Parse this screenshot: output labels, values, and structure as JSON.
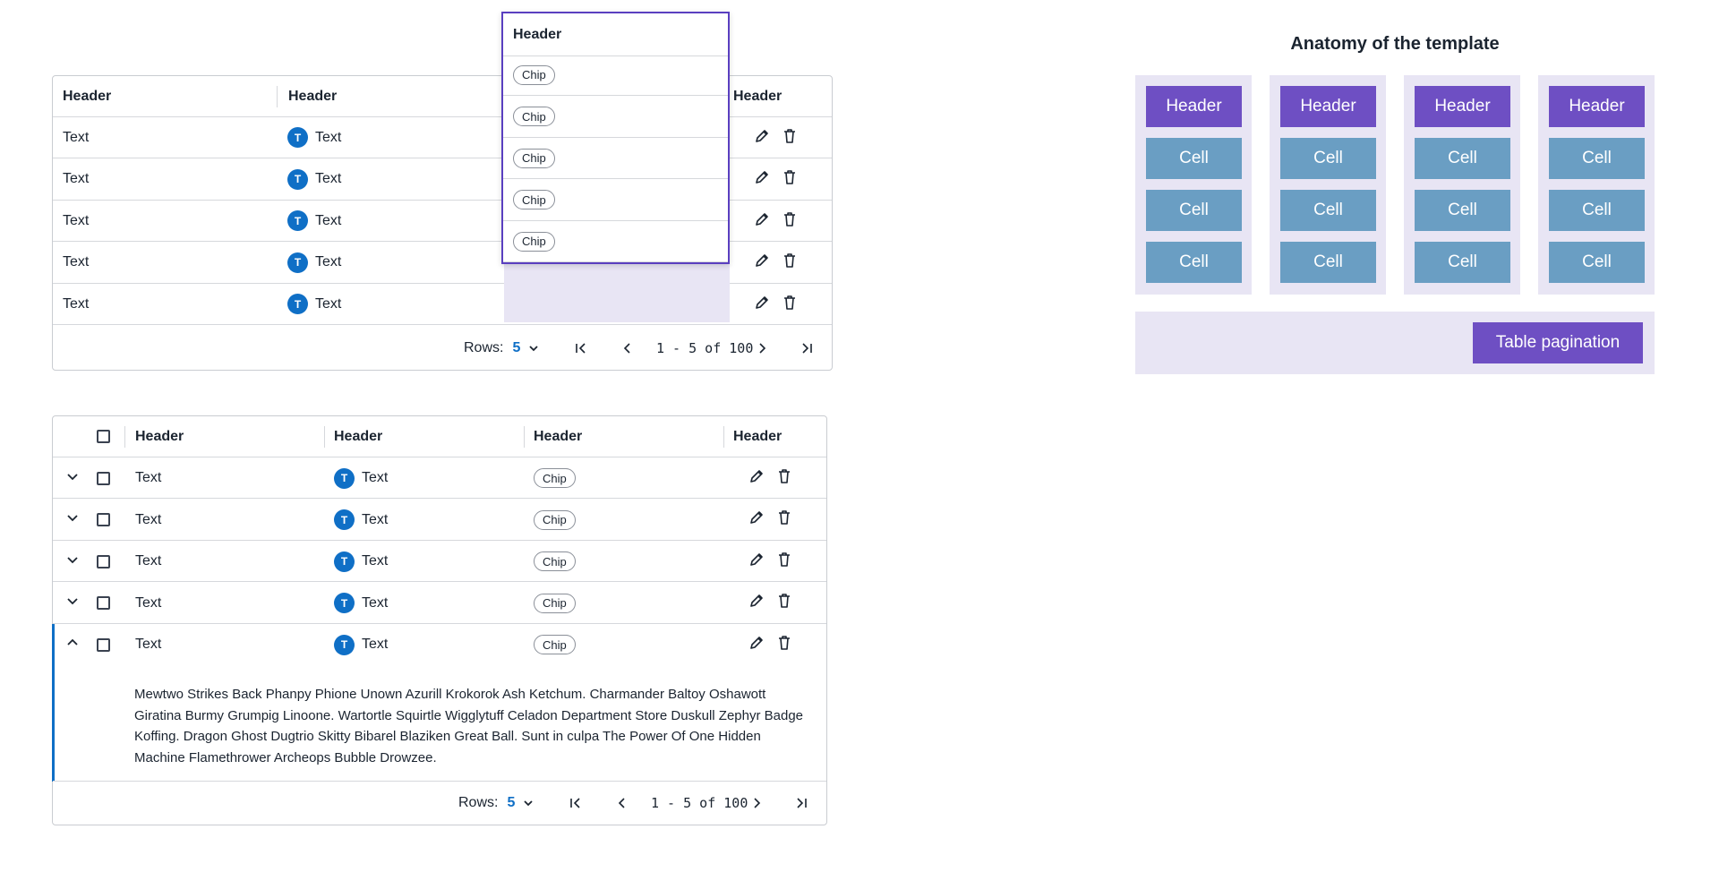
{
  "table1": {
    "headers": [
      "Header",
      "Header",
      "Header"
    ],
    "rows": [
      {
        "text": "Text",
        "avatar": "T",
        "user": "Text"
      },
      {
        "text": "Text",
        "avatar": "T",
        "user": "Text"
      },
      {
        "text": "Text",
        "avatar": "T",
        "user": "Text"
      },
      {
        "text": "Text",
        "avatar": "T",
        "user": "Text"
      },
      {
        "text": "Text",
        "avatar": "T",
        "user": "Text"
      }
    ],
    "pagination": {
      "rows_label": "Rows:",
      "rows_value": "5",
      "range": "1 - 5 of 100"
    }
  },
  "dragged_column": {
    "header": "Header",
    "chips": [
      "Chip",
      "Chip",
      "Chip",
      "Chip",
      "Chip"
    ]
  },
  "table2": {
    "headers": [
      "Header",
      "Header",
      "Header",
      "Header"
    ],
    "rows": [
      {
        "text": "Text",
        "avatar": "T",
        "user": "Text",
        "chip": "Chip"
      },
      {
        "text": "Text",
        "avatar": "T",
        "user": "Text",
        "chip": "Chip"
      },
      {
        "text": "Text",
        "avatar": "T",
        "user": "Text",
        "chip": "Chip"
      },
      {
        "text": "Text",
        "avatar": "T",
        "user": "Text",
        "chip": "Chip"
      },
      {
        "text": "Text",
        "avatar": "T",
        "user": "Text",
        "chip": "Chip"
      }
    ],
    "expanded_text": "Mewtwo Strikes Back Phanpy Phione Unown Azurill Krokorok Ash Ketchum. Charmander Baltoy Oshawott Giratina Burmy Grumpig Linoone. Wartortle Squirtle Wigglytuff Celadon Department Store Duskull Zephyr Badge Koffing. Dragon Ghost Dugtrio Skitty Bibarel Blaziken Great Ball. Sunt in culpa The Power Of One Hidden Machine Flamethrower Archeops Bubble Drowzee.",
    "pagination": {
      "rows_label": "Rows:",
      "rows_value": "5",
      "range": "1 - 5 of 100"
    }
  },
  "anatomy": {
    "title": "Anatomy of the template",
    "columns": [
      {
        "header": "Header",
        "cells": [
          "Cell",
          "Cell",
          "Cell"
        ]
      },
      {
        "header": "Header",
        "cells": [
          "Cell",
          "Cell",
          "Cell"
        ]
      },
      {
        "header": "Header",
        "cells": [
          "Cell",
          "Cell",
          "Cell"
        ]
      },
      {
        "header": "Header",
        "cells": [
          "Cell",
          "Cell",
          "Cell"
        ]
      }
    ],
    "pagination_label": "Table pagination"
  },
  "colors": {
    "accent_purple": "#6e4fc3",
    "cell_blue": "#6a9ec3",
    "avatar_blue": "#0f6fc6",
    "lavender_bg": "#e8e5f4"
  }
}
